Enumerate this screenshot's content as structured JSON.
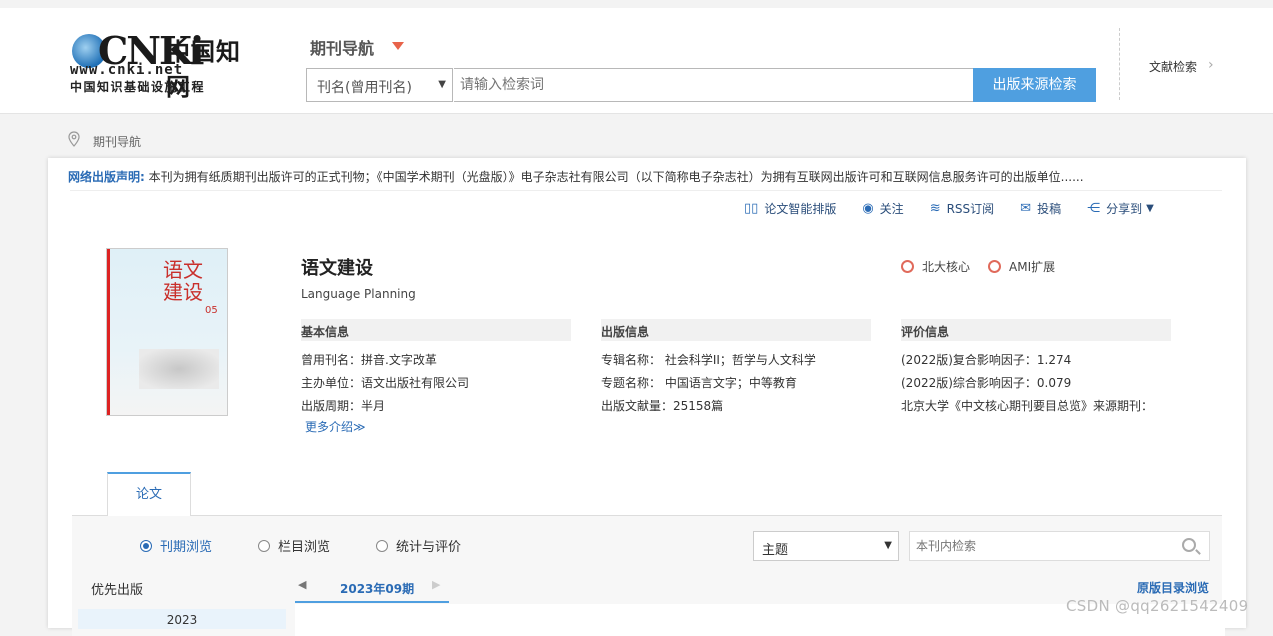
{
  "header": {
    "logo_word": "CNKi",
    "logo_cn": "中国知网",
    "logo_url": "www.cnki.net",
    "logo_sub": "中国知识基础设施工程",
    "nav_title": "期刊导航",
    "search_type": "刊名(曾用刊名)",
    "search_placeholder": "请输入检索词",
    "search_button": "出版来源检索",
    "literature_search": "文献检索",
    "accent": "#4f9fe0"
  },
  "breadcrumb": {
    "label": "期刊导航"
  },
  "notice": {
    "label": "网络出版声明:",
    "text": "本刊为拥有纸质期刊出版许可的正式刊物；《中国学术期刊（光盘版）》电子杂志社有限公司（以下简称电子杂志社）为拥有互联网出版许可和互联网信息服务许可的出版单位......"
  },
  "toolbar": {
    "layout": "论文智能排版",
    "follow": "关注",
    "rss": "RSS订阅",
    "submit": "投稿",
    "share": "分享到"
  },
  "journal": {
    "cover_title": "语文建设",
    "cover_issue": "05",
    "title": "语文建设",
    "english": "Language Planning",
    "badges": [
      "北大核心",
      "AMI扩展"
    ],
    "basic_head": "基本信息",
    "basic": [
      "曾用刊名：拼音.文字改革",
      "主办单位：语文出版社有限公司",
      "出版周期：半月"
    ],
    "pub_head": "出版信息",
    "pub": [
      "专辑名称：  社会科学II；哲学与人文科学",
      "专题名称：  中国语言文字；中等教育",
      "出版文献量：25158篇"
    ],
    "eval_head": "评价信息",
    "eval": [
      "(2022版)复合影响因子：1.274",
      "(2022版)综合影响因子：0.079",
      "北京大学《中文核心期刊要目总览》来源期刊："
    ],
    "more": "更多介绍≫"
  },
  "tabs": {
    "papers": "论文"
  },
  "browse": {
    "options": [
      "刊期浏览",
      "栏目浏览",
      "统计与评价"
    ],
    "theme": "主题",
    "inner_search": "本刊内检索",
    "priority": "优先出版",
    "year": "2023",
    "issue": "2023年09期",
    "original": "原版目录浏览"
  },
  "watermark": "CSDN @qq2621542409"
}
